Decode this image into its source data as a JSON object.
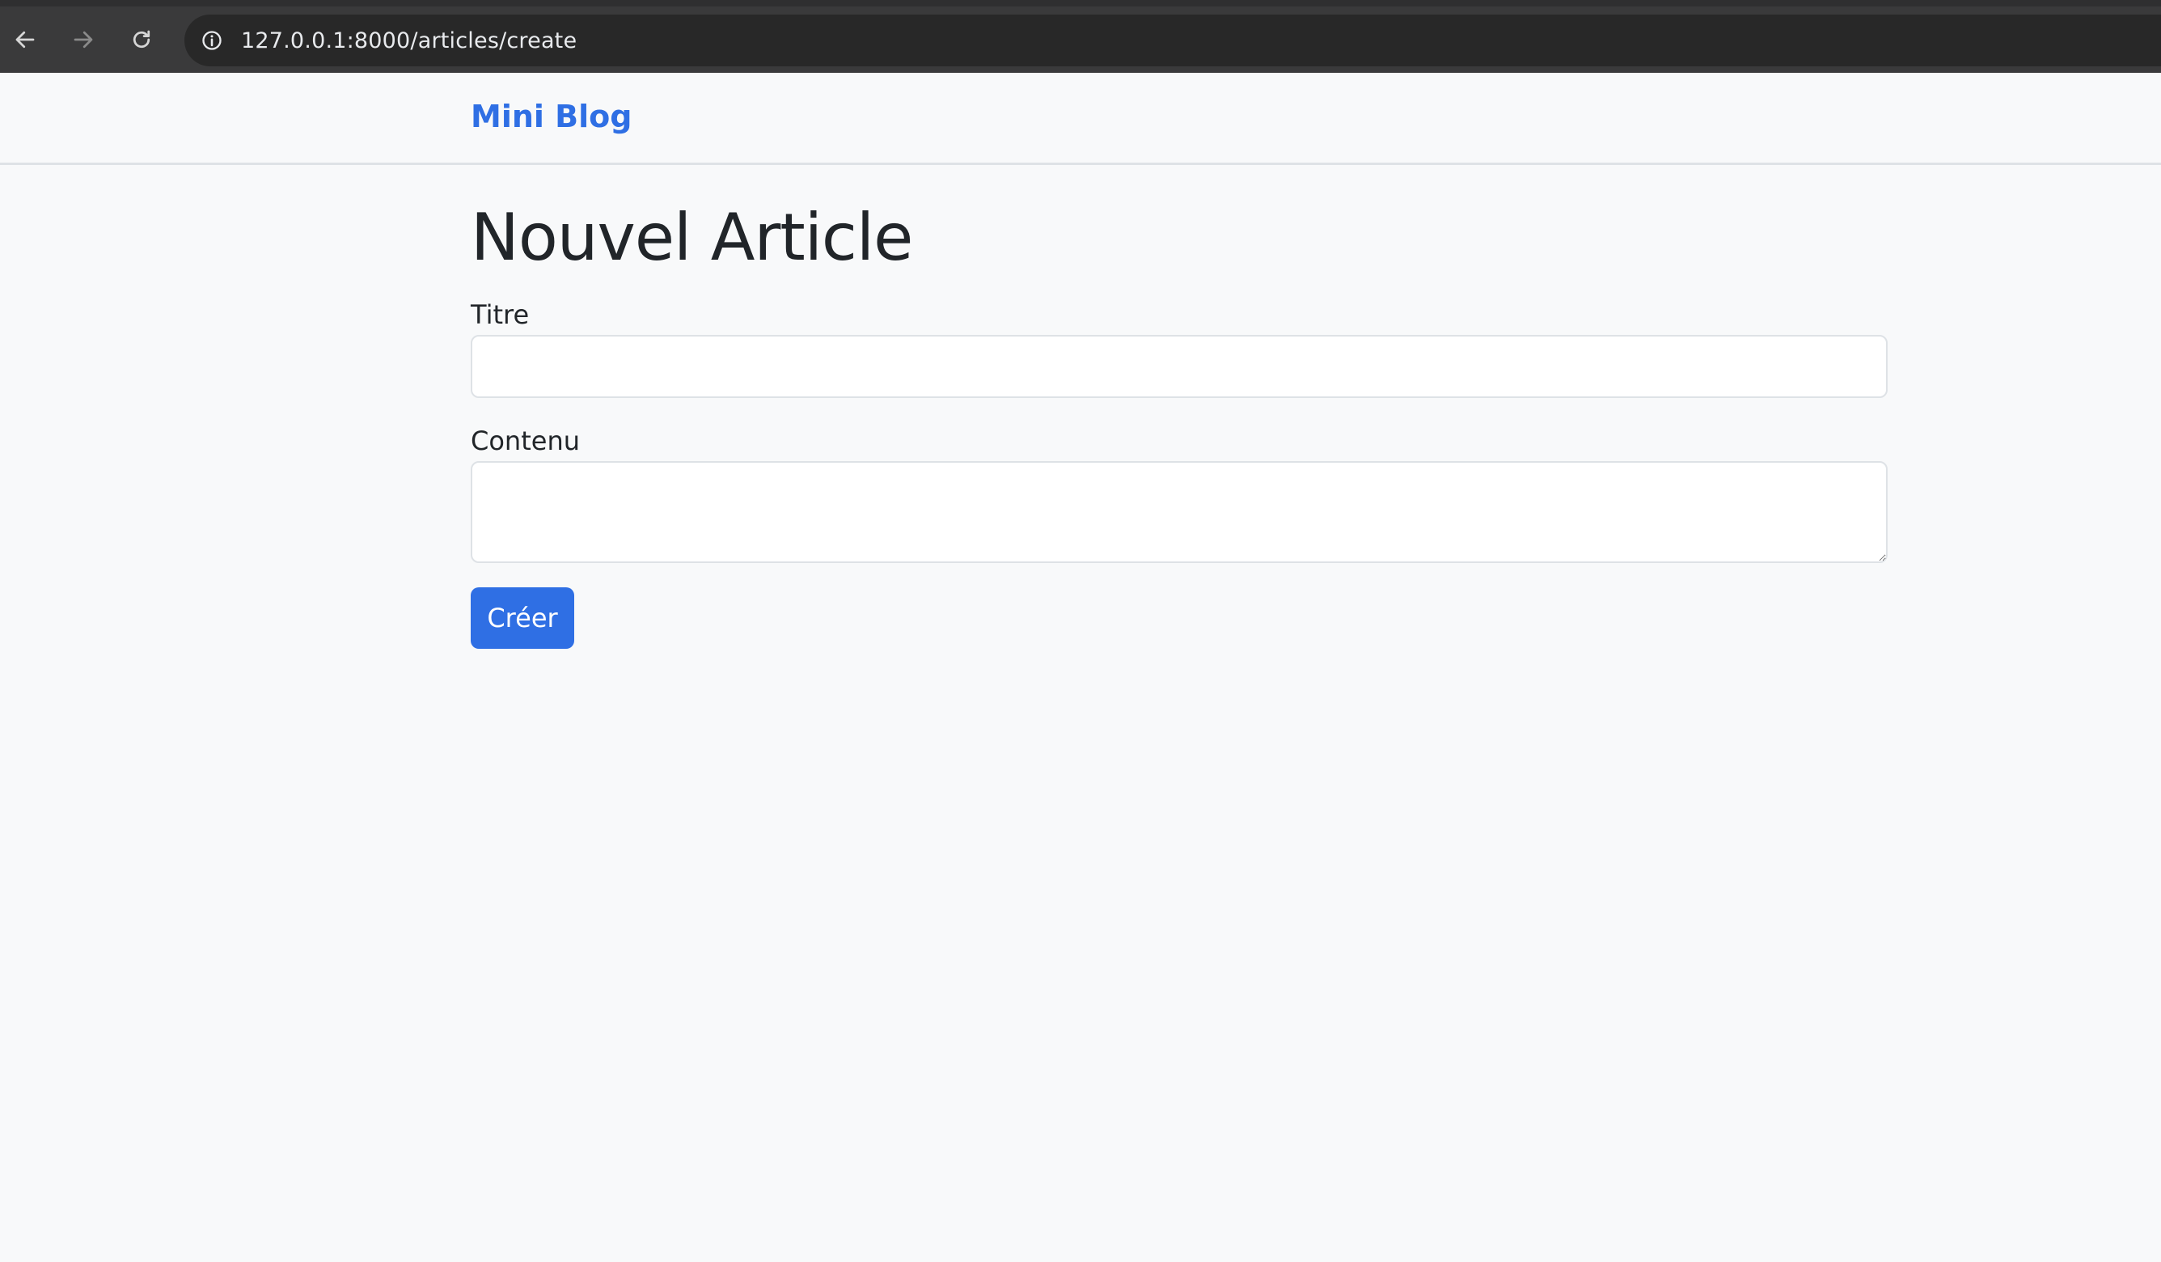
{
  "browser": {
    "url": "127.0.0.1:8000/articles/create",
    "icons": [
      "back-arrow-icon",
      "forward-arrow-icon",
      "reload-icon",
      "site-info-icon"
    ]
  },
  "header": {
    "brand": "Mini Blog"
  },
  "main": {
    "title": "Nouvel Article",
    "fields": {
      "title_label": "Titre",
      "title_value": "",
      "content_label": "Contenu",
      "content_value": ""
    },
    "submit_label": "Créer"
  },
  "colors": {
    "accent": "#2f6fe4",
    "page_bg": "#f8f9fa",
    "text": "#212529",
    "browser_bar": "#3a3a3b",
    "omnibox": "#282828"
  }
}
